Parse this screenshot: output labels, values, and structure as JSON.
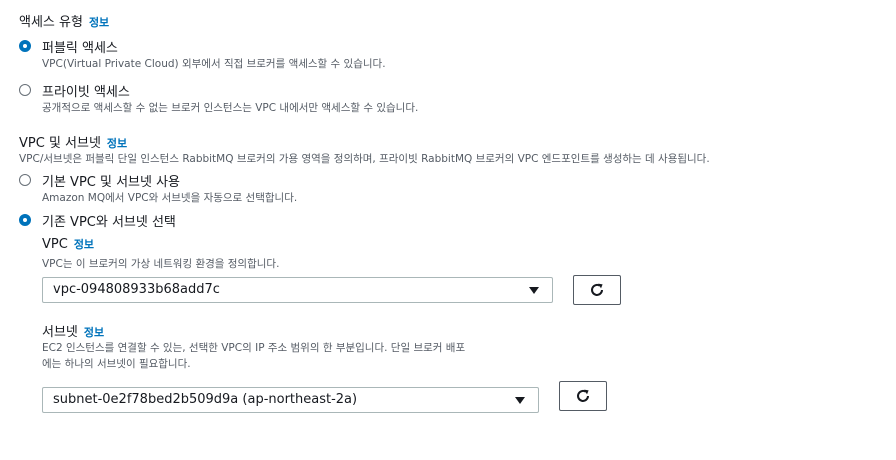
{
  "info_link": "정보",
  "access": {
    "title": "액세스 유형",
    "options": [
      {
        "label": "퍼블릭 액세스",
        "description": "VPC(Virtual Private Cloud) 외부에서 직접 브로커를 액세스할 수 있습니다.",
        "selected": true
      },
      {
        "label": "프라이빗 액세스",
        "description": "공개적으로 액세스할 수 없는 브로커 인스턴스는 VPC 내에서만 액세스할 수 있습니다.",
        "selected": false
      }
    ]
  },
  "vpc_subnet": {
    "title": "VPC 및 서브넷",
    "description": "VPC/서브넷은 퍼블릭 단일 인스턴스 RabbitMQ 브로커의 가용 영역을 정의하며, 프라이빗 RabbitMQ 브로커의 VPC 엔드포인트를 생성하는 데 사용됩니다.",
    "options": [
      {
        "label": "기본 VPC 및 서브넷 사용",
        "description": "Amazon MQ에서 VPC와 서브넷을 자동으로 선택합니다.",
        "selected": false
      },
      {
        "label": "기존 VPC와 서브넷 선택",
        "description": "",
        "selected": true
      }
    ]
  },
  "vpc": {
    "label": "VPC",
    "description": "VPC는 이 브로커의 가상 네트워킹 환경을 정의합니다.",
    "value": "vpc-094808933b68add7c"
  },
  "subnet": {
    "label": "서브넷",
    "description_line1": "EC2 인스턴스를 연결할 수 있는, 선택한 VPC의 IP 주소 범위의 한 부분입니다. 단일 브로커 배포",
    "description_line2": "에는 하나의 서브넷이 필요합니다.",
    "value": "subnet-0e2f78bed2b509d9a (ap-northeast-2a)"
  },
  "colors": {
    "accent": "#0073bb",
    "text": "#16191f",
    "muted": "#545b64",
    "border": "#aab7b8"
  }
}
